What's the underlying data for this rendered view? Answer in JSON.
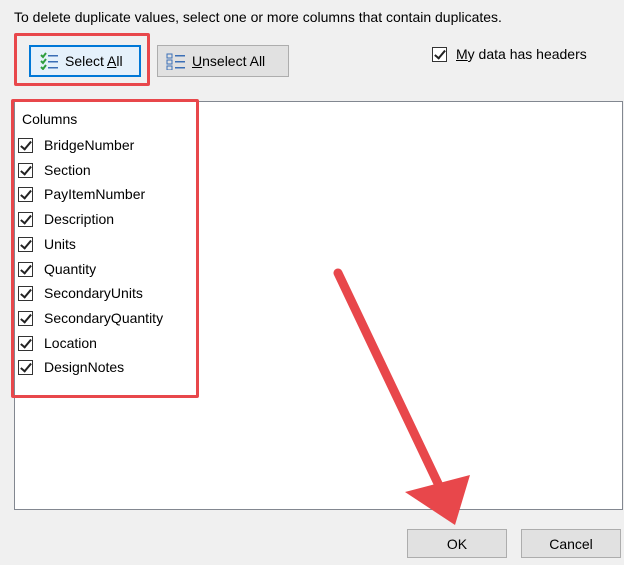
{
  "instruction": "To delete duplicate values, select one or more columns that contain duplicates.",
  "buttons": {
    "select_all_prefix": "Select ",
    "select_all_accel": "A",
    "select_all_suffix": "ll",
    "unselect_all_accel": "U",
    "unselect_all_suffix": "nselect All",
    "ok": "OK",
    "cancel": "Cancel"
  },
  "headers_checkbox": {
    "checked": true,
    "label_accel": "M",
    "label_suffix": "y data has headers"
  },
  "columns": {
    "header": "Columns",
    "items": [
      {
        "label": "BridgeNumber",
        "checked": true
      },
      {
        "label": "Section",
        "checked": true
      },
      {
        "label": "PayItemNumber",
        "checked": true
      },
      {
        "label": "Description",
        "checked": true
      },
      {
        "label": "Units",
        "checked": true
      },
      {
        "label": "Quantity",
        "checked": true
      },
      {
        "label": "SecondaryUnits",
        "checked": true
      },
      {
        "label": "SecondaryQuantity",
        "checked": true
      },
      {
        "label": "Location",
        "checked": true
      },
      {
        "label": "DesignNotes",
        "checked": true
      }
    ]
  },
  "colors": {
    "annotation_red": "#e8474b",
    "focus_blue": "#0078d7"
  }
}
